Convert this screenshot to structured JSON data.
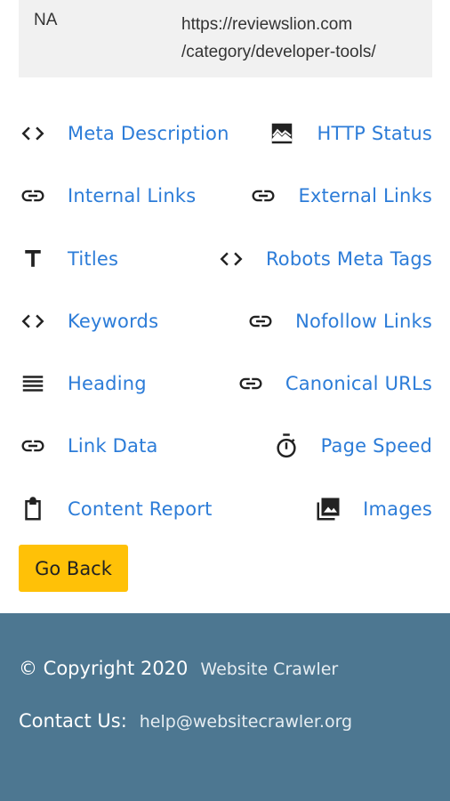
{
  "details": {
    "value": "NA",
    "url_line1": "https://reviewslion.com",
    "url_line2": "/category/developer-tools/"
  },
  "links": [
    {
      "label": "Meta Description",
      "icon": "code-icon"
    },
    {
      "label": "HTTP Status",
      "icon": "image-landscape-icon"
    },
    {
      "label": "Internal Links",
      "icon": "link-icon"
    },
    {
      "label": "External Links",
      "icon": "link-icon"
    },
    {
      "label": "Titles",
      "icon": "title-icon"
    },
    {
      "label": "Robots Meta Tags",
      "icon": "code-icon"
    },
    {
      "label": "Keywords",
      "icon": "code-icon"
    },
    {
      "label": "Nofollow Links",
      "icon": "link-icon"
    },
    {
      "label": "Heading",
      "icon": "list-icon"
    },
    {
      "label": "Canonical URLs",
      "icon": "link-icon"
    },
    {
      "label": "Link Data",
      "icon": "link-icon"
    },
    {
      "label": "Page Speed",
      "icon": "timer-icon"
    },
    {
      "label": "Content Report",
      "icon": "clipboard-icon"
    },
    {
      "label": "Images",
      "icon": "photo-library-icon"
    }
  ],
  "go_back": "Go Back",
  "footer": {
    "copyright": "© Copyright 2020",
    "site": "Website Crawler",
    "contact_label": "Contact Us:",
    "email": "help@websitecrawler.org"
  },
  "colors": {
    "link": "#2c7cd8",
    "button": "#ffc107",
    "footer_bg": "#4d7791"
  }
}
